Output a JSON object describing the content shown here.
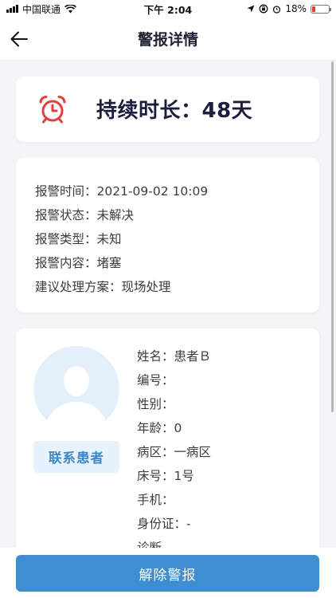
{
  "status_bar": {
    "carrier": "中国联通",
    "time": "下午 2:04",
    "battery_percent": "18%",
    "battery_level": 0.18,
    "battery_color": "#e53935"
  },
  "nav": {
    "title": "警报详情",
    "back_icon": "arrow-left-icon"
  },
  "duration": {
    "icon": "alarm-clock-icon",
    "icon_color": "#e0413a",
    "text": "持续时长：48天"
  },
  "alert_info": [
    {
      "label": "报警时间：",
      "value": "2021-09-02 10:09"
    },
    {
      "label": "报警状态：",
      "value": "未解决"
    },
    {
      "label": "报警类型：",
      "value": "未知"
    },
    {
      "label": "报警内容：",
      "value": "堵塞"
    },
    {
      "label": "建议处理方案：",
      "value": "现场处理"
    }
  ],
  "patient": {
    "avatar_icon": "user-avatar-icon",
    "contact_label": "联系患者",
    "fields": [
      {
        "label": "姓名：",
        "value": "患者Ｂ"
      },
      {
        "label": "编号：",
        "value": ""
      },
      {
        "label": "性别：",
        "value": ""
      },
      {
        "label": "年龄：",
        "value": "0"
      },
      {
        "label": "病区：",
        "value": "一病区"
      },
      {
        "label": "床号：",
        "value": "1号"
      },
      {
        "label": "手机：",
        "value": ""
      },
      {
        "label": "身份证：",
        "value": "-"
      },
      {
        "label": "诊断",
        "value": ""
      }
    ]
  },
  "actions": {
    "release_label": "解除警报"
  },
  "colors": {
    "primary": "#3e8ed0",
    "title_dark": "#1b1f3d",
    "alarm_red": "#e0413a",
    "avatar_bg": "#e3f0fc"
  }
}
